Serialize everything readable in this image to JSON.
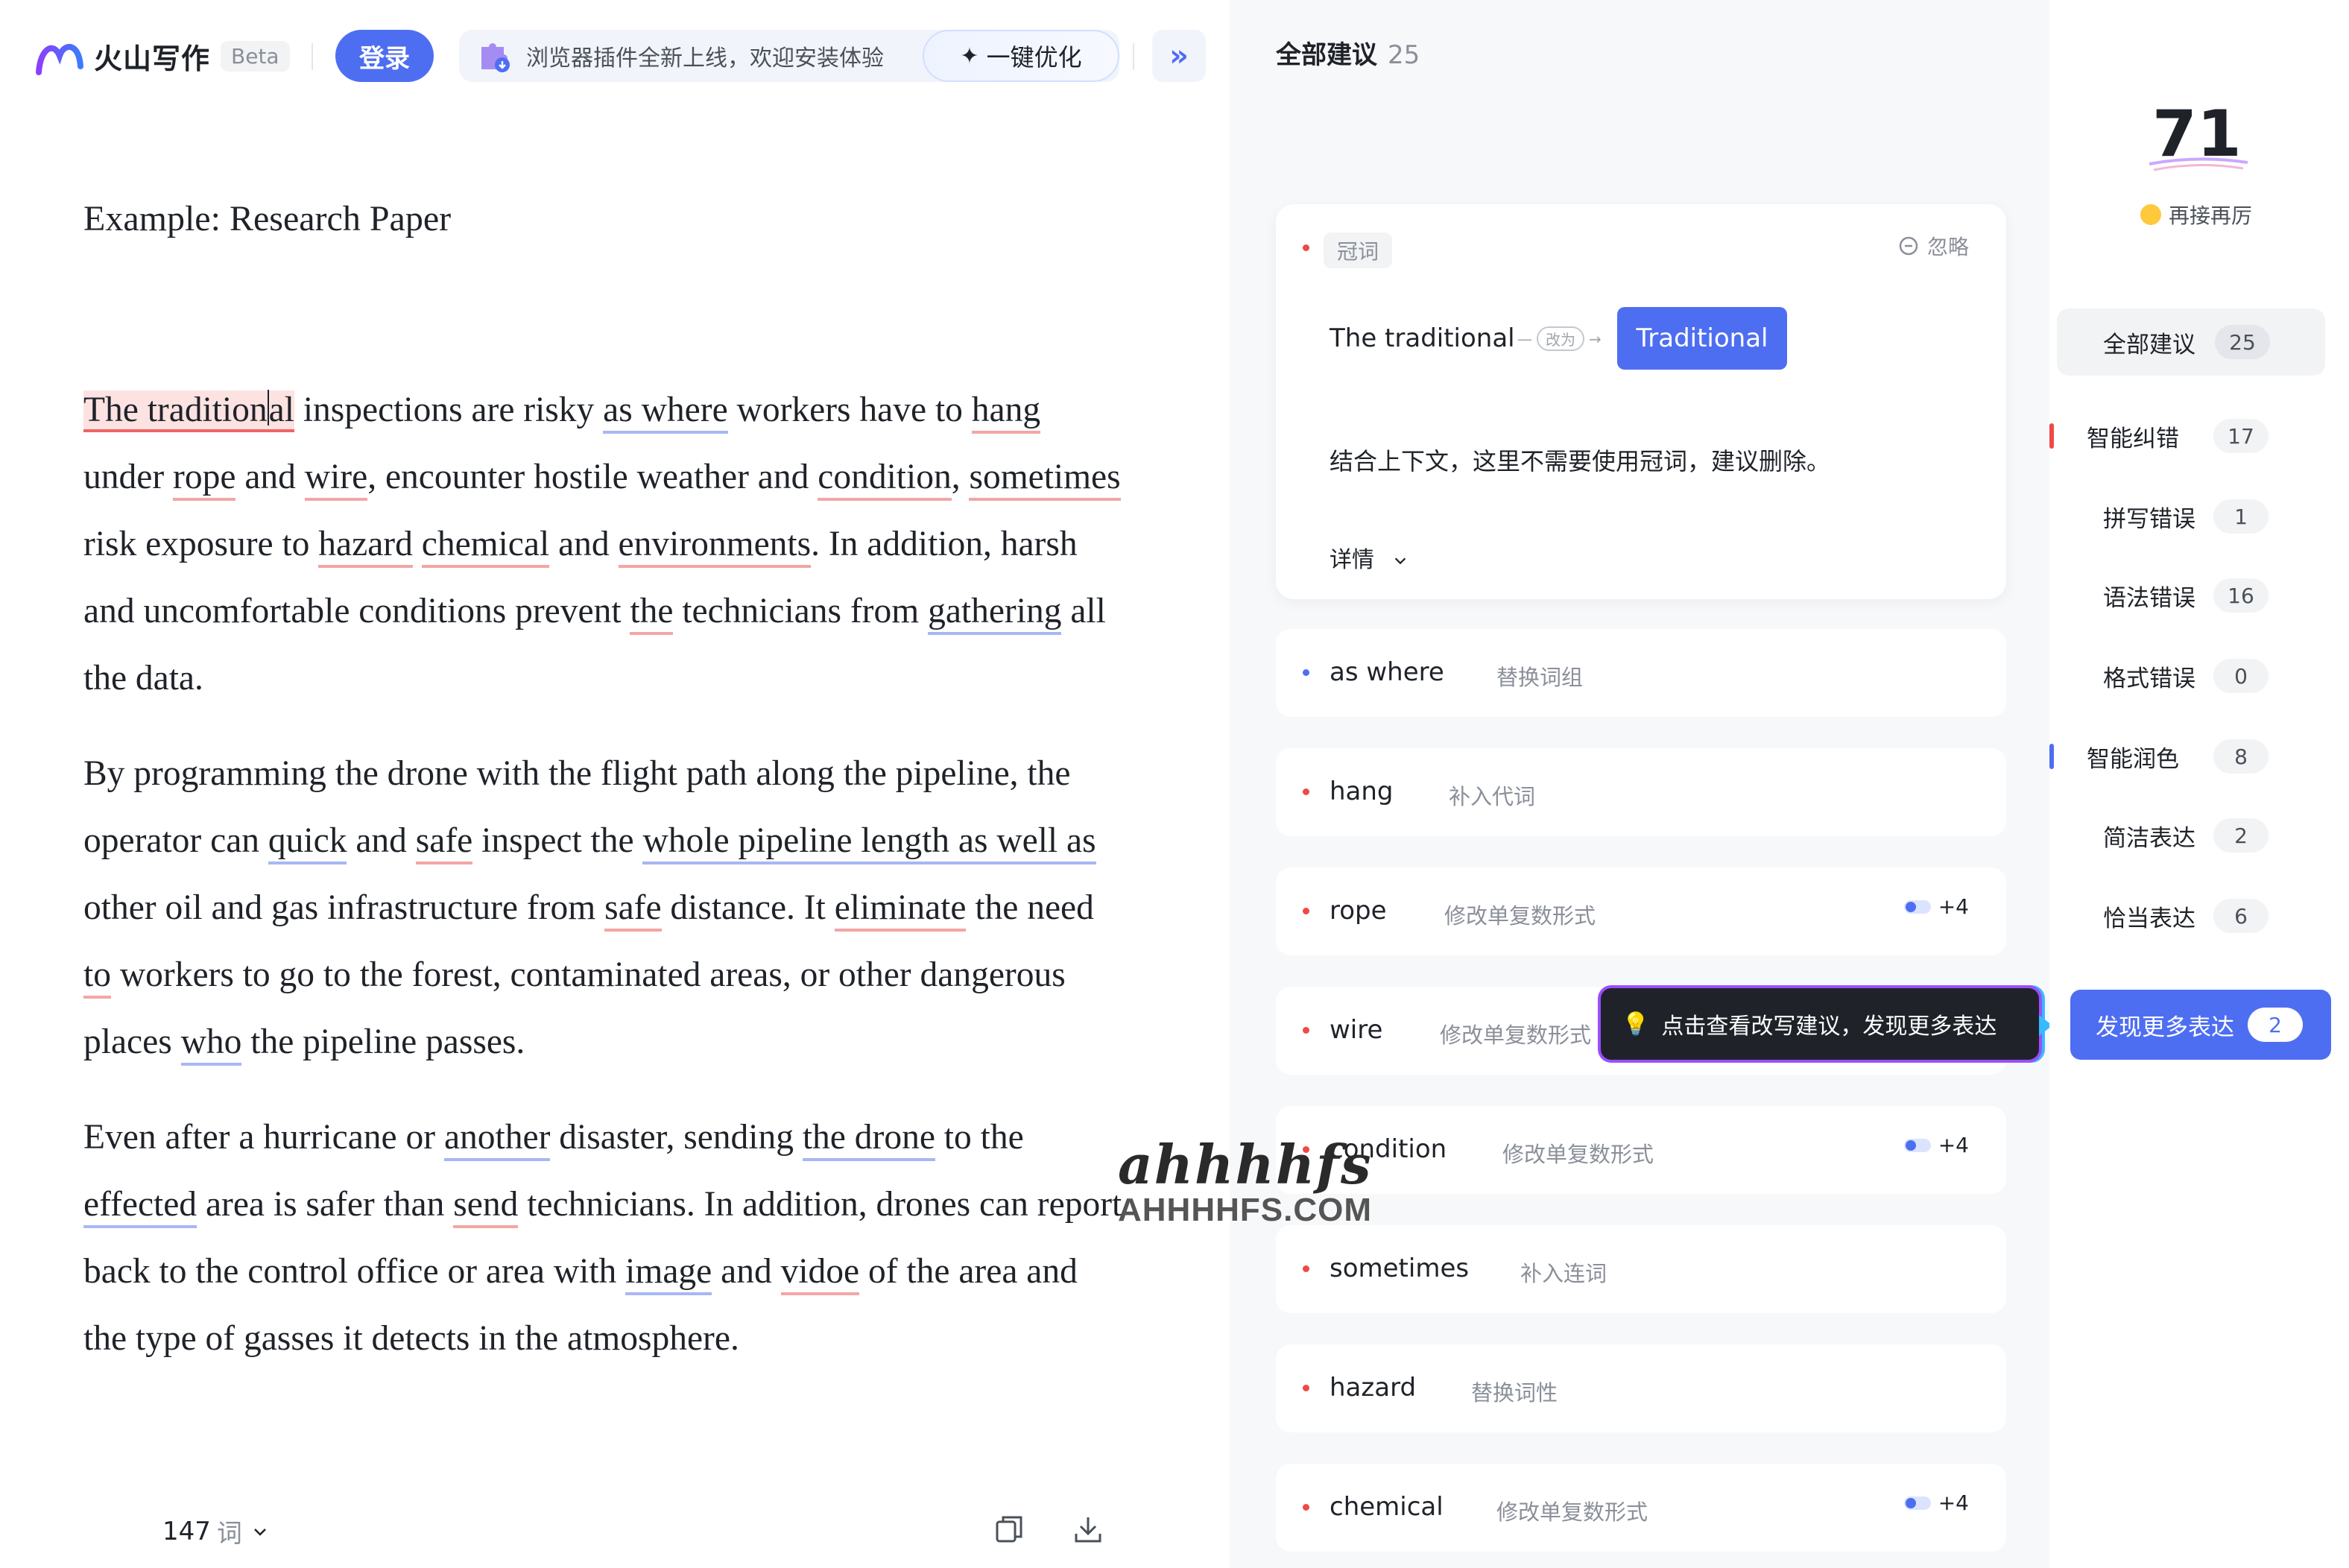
{
  "app": {
    "name": "火山写作",
    "beta_label": "Beta",
    "login_label": "登录",
    "banner_text": "浏览器插件全新上线，欢迎安装体验",
    "optimize_label": "一键优化",
    "expand_icon": "double-chevron-right-icon"
  },
  "document": {
    "title": "Example: Research Paper",
    "p1": {
      "s1": "The tradition",
      "s1b": "al",
      "s2": " inspections are risky ",
      "w_as_where": "as where",
      "s3": " workers have to ",
      "w_hang": "hang",
      "s4": " under ",
      "w_rope": "rope",
      "s5": " and ",
      "w_wire": "wire",
      "s6": ", encounter hostile weather and ",
      "w_condition": "condition",
      "s7": ", ",
      "w_sometimes": "sometimes",
      "s8": " risk exposure to ",
      "w_hazard": "hazard",
      "s9": " ",
      "w_chemical": "chemical",
      "s10": " and ",
      "w_environments": "environments",
      "s11": ". In addition, harsh and uncomfortable conditions prevent ",
      "w_the": "the",
      "s12": " technicians from ",
      "w_gathering": "gathering",
      "s13": " all the data."
    },
    "p2": {
      "s1": "By programming the drone with the flight path along the pipeline, the operator can ",
      "w_quick": "quick",
      "s2": " and ",
      "w_safe": "safe",
      "s3": " inspect the ",
      "w_whole": "whole pipeline length as well as",
      "s4": " other oil and gas infrastructure from ",
      "w_safe2": "safe",
      "s5": " distance. It ",
      "w_eliminate": "eliminate",
      "s6": " the need ",
      "w_to": "to",
      "s7": " workers to go to the forest, contaminated areas, or other dangerous places ",
      "w_who": "who",
      "s8": " the pipeline passes."
    },
    "p3": {
      "s1": "Even after a hurricane or ",
      "w_another": "another",
      "s2": " disaster, sending ",
      "w_the_drone": "the drone",
      "s3": " to the ",
      "w_effected": "effected",
      "s4": " area is safer than ",
      "w_send": "send",
      "s5": " technicians. In addition, drones can report back to the control office or area with ",
      "w_image": "image",
      "s6": " and ",
      "w_vidoe": "vidoe",
      "s7": " of the area and the type of gasses it detects in the atmosphere."
    },
    "word_count": "147",
    "word_unit": "词"
  },
  "suggestions": {
    "header": "全部建议",
    "count": "25",
    "active": {
      "tag": "冠词",
      "ignore_label": "忽略",
      "original": "The traditional",
      "change_label": "改为",
      "replacement": "Traditional",
      "explanation": "结合上下文，这里不需要使用冠词，建议删除。",
      "details_label": "详情"
    },
    "items": [
      {
        "word": "as where",
        "type": "替换词组",
        "dot": "blue",
        "extra": ""
      },
      {
        "word": "hang",
        "type": "补入代词",
        "dot": "red",
        "extra": ""
      },
      {
        "word": "rope",
        "type": "修改单复数形式",
        "dot": "red",
        "extra": "+4"
      },
      {
        "word": "wire",
        "type": "修改单复数形式",
        "dot": "red",
        "extra": ""
      },
      {
        "word": "condition",
        "type": "修改单复数形式",
        "dot": "red",
        "extra": "+4"
      },
      {
        "word": "sometimes",
        "type": "补入连词",
        "dot": "red",
        "extra": ""
      },
      {
        "word": "hazard",
        "type": "替换词性",
        "dot": "red",
        "extra": ""
      },
      {
        "word": "chemical",
        "type": "修改单复数形式",
        "dot": "red",
        "extra": "+4"
      }
    ],
    "tooltip": "点击查看改写建议，发现更多表达"
  },
  "score_panel": {
    "score": "71",
    "score_label": "再接再厉",
    "nav": [
      {
        "label": "全部建议",
        "count": "25"
      },
      {
        "label": "智能纠错",
        "count": "17"
      },
      {
        "label": "拼写错误",
        "count": "1"
      },
      {
        "label": "语法错误",
        "count": "16"
      },
      {
        "label": "格式错误",
        "count": "0"
      },
      {
        "label": "智能润色",
        "count": "8"
      },
      {
        "label": "简洁表达",
        "count": "2"
      },
      {
        "label": "恰当表达",
        "count": "6"
      }
    ],
    "discover_label": "发现更多表达",
    "discover_count": "2"
  },
  "watermark": {
    "top": "ahhhhfs",
    "bottom": "AHHHHFS.COM"
  },
  "colors": {
    "accent": "#4e6ef2",
    "error_red": "#f04848",
    "underline_red": "#f4a5a5",
    "underline_blue": "#a7b7f5"
  }
}
